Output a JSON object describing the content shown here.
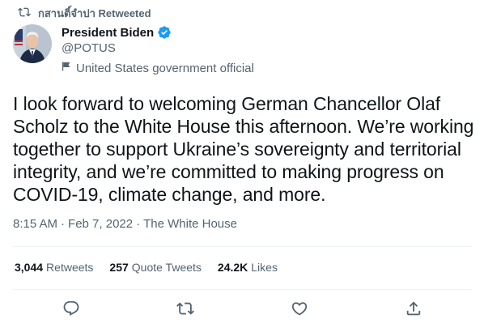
{
  "retweet": {
    "user": "กสานติ์จำปา",
    "label": "Retweeted",
    "icon": "retweet-icon"
  },
  "author": {
    "name": "President Biden",
    "handle": "@POTUS",
    "verified_icon": "verified-badge-icon",
    "label": "United States government official",
    "label_icon": "flag-icon",
    "verified_color": "#1d9bf0"
  },
  "tweet": {
    "text": "I look forward to welcoming German Chancellor Olaf Scholz to the White House this afternoon. We’re working together to support Ukraine’s sovereignty and territorial integrity, and we’re committed to making progress on COVID-19, climate change, and more.",
    "time": "8:15 AM",
    "sep1": "·",
    "date": "Feb 7, 2022",
    "sep2": "·",
    "source": "The White House"
  },
  "stats": {
    "retweets_count": "3,044",
    "retweets_label": "Retweets",
    "quotes_count": "257",
    "quotes_label": "Quote Tweets",
    "likes_count": "24.2K",
    "likes_label": "Likes"
  },
  "actions": {
    "reply_icon": "reply-icon",
    "retweet_icon": "retweet-icon",
    "like_icon": "heart-icon",
    "share_icon": "share-icon"
  },
  "colors": {
    "text_primary": "#0f1419",
    "text_secondary": "#536471",
    "divider": "#eff3f4"
  }
}
